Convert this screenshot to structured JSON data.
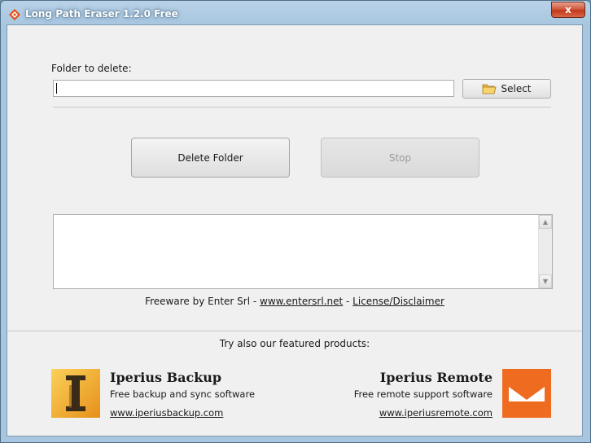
{
  "window": {
    "title": "Long Path Eraser 1.2.0  Free",
    "close_glyph": "x"
  },
  "folder": {
    "label": "Folder to delete:",
    "value": "",
    "select_label": "Select"
  },
  "actions": {
    "delete_label": "Delete Folder",
    "stop_label": "Stop"
  },
  "footer": {
    "prefix": "Freeware by Enter Srl - ",
    "site_link": "www.entersrl.net",
    "separator": " - ",
    "license_link": "License/Disclaimer"
  },
  "featured": {
    "heading": "Try also our featured products:",
    "products": [
      {
        "name": "Iperius Backup",
        "description": "Free backup and sync software",
        "link": "www.iperiusbackup.com",
        "icon": "iperius-backup-logo",
        "accent": "#f5a623"
      },
      {
        "name": "Iperius Remote",
        "description": "Free remote support software",
        "link": "www.iperiusremote.com",
        "icon": "iperius-remote-logo",
        "accent": "#ef6b1f"
      }
    ]
  },
  "colors": {
    "window_frame": "#a8c6e0",
    "client_bg": "#f0f0f0",
    "close_button": "#c8462a"
  }
}
